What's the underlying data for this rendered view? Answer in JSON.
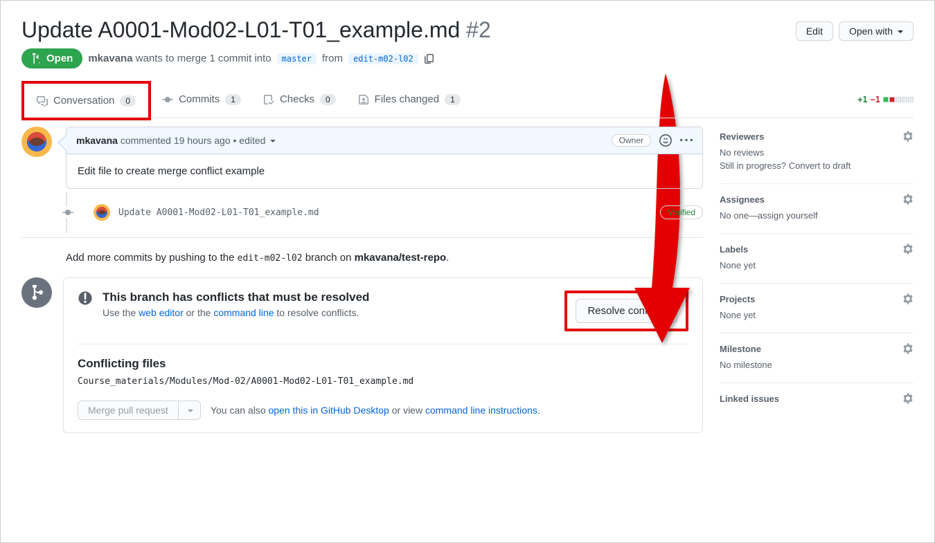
{
  "pr": {
    "title": "Update A0001-Mod02-L01-T01_example.md",
    "number": "#2",
    "state": "Open",
    "author": "mkavana",
    "merge_text_1": "wants to merge 1 commit into",
    "base_branch": "master",
    "merge_text_2": "from",
    "head_branch": "edit-m02-l02"
  },
  "header_buttons": {
    "edit": "Edit",
    "open_with": "Open with"
  },
  "tabs": {
    "conversation": {
      "label": "Conversation",
      "count": "0"
    },
    "commits": {
      "label": "Commits",
      "count": "1"
    },
    "checks": {
      "label": "Checks",
      "count": "0"
    },
    "files": {
      "label": "Files changed",
      "count": "1"
    }
  },
  "diffstat": {
    "plus": "+1",
    "minus": "−1"
  },
  "comment": {
    "author": "mkavana",
    "action": "commented",
    "time": "19 hours ago",
    "edited": "edited",
    "owner_badge": "Owner",
    "body": "Edit file to create merge conflict example"
  },
  "commit": {
    "message": "Update A0001-Mod02-L01-T01_example.md",
    "verified": "Verified"
  },
  "push_note": {
    "prefix": "Add more commits by pushing to the ",
    "branch": "edit-m02-l02",
    "middle": " branch on ",
    "repo": "mkavana/test-repo",
    "suffix": "."
  },
  "conflict": {
    "title": "This branch has conflicts that must be resolved",
    "hint_prefix": "Use the ",
    "web_editor": "web editor",
    "or": " or the ",
    "command_line": "command line",
    "hint_suffix": " to resolve conflicts.",
    "resolve_btn": "Resolve conflicts",
    "files_title": "Conflicting files",
    "file_path": "Course_materials/Modules/Mod-02/A0001-Mod02-L01-T01_example.md"
  },
  "merge_actions": {
    "merge_btn": "Merge pull request",
    "note_prefix": "You can also ",
    "desktop_link": "open this in GitHub Desktop",
    "note_mid": " or view ",
    "cli_link": "command line instructions",
    "note_suffix": "."
  },
  "sidebar": {
    "reviewers": {
      "title": "Reviewers",
      "line1": "No reviews",
      "line2_a": "Still in progress? ",
      "line2_b": "Convert to draft"
    },
    "assignees": {
      "title": "Assignees",
      "text_a": "No one—",
      "text_b": "assign yourself"
    },
    "labels": {
      "title": "Labels",
      "text": "None yet"
    },
    "projects": {
      "title": "Projects",
      "text": "None yet"
    },
    "milestone": {
      "title": "Milestone",
      "text": "No milestone"
    },
    "linked": {
      "title": "Linked issues"
    }
  }
}
